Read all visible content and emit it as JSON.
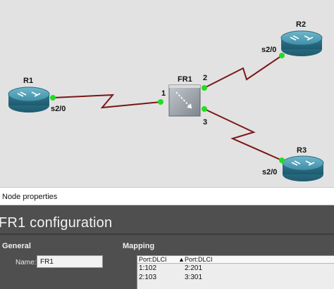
{
  "topology": {
    "nodes": [
      {
        "id": "R1",
        "label": "R1"
      },
      {
        "id": "FR1",
        "label": "FR1"
      },
      {
        "id": "R2",
        "label": "R2"
      },
      {
        "id": "R3",
        "label": "R3"
      }
    ],
    "links": [
      {
        "from": "R1",
        "from_port": "s2/0",
        "to": "FR1",
        "to_port": "1"
      },
      {
        "from": "FR1",
        "from_port": "2",
        "to": "R2",
        "to_port": "s2/0"
      },
      {
        "from": "FR1",
        "from_port": "3",
        "to": "R3",
        "to_port": "s2/0"
      }
    ],
    "colors": {
      "link": "#7a1717",
      "port_dot": "#22dd22",
      "router": "#3f8fa8",
      "switch": "#9aa1a8"
    }
  },
  "node_properties": {
    "header": "Node properties",
    "title": "FR1 configuration",
    "general": {
      "heading": "General",
      "name_label": "Name:",
      "name_value": "FR1"
    },
    "mapping": {
      "heading": "Mapping",
      "columns": [
        "Port:DLCI",
        "Port:DLCI"
      ],
      "rows": [
        [
          "1:102",
          "2:201"
        ],
        [
          "2:103",
          "3:301"
        ]
      ]
    }
  }
}
